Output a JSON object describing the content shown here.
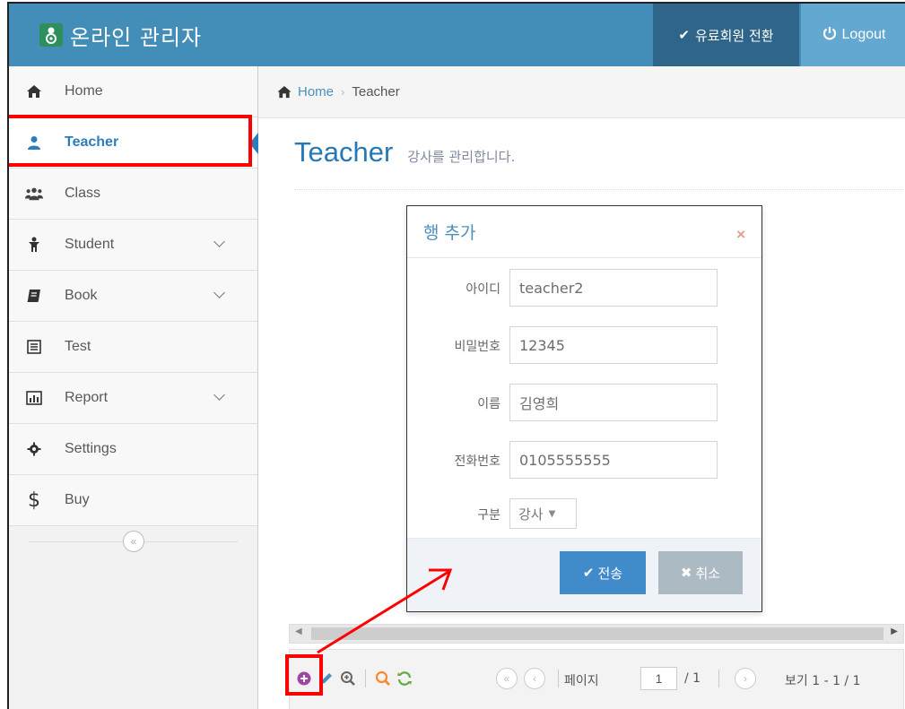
{
  "app": {
    "title": "온라인 관리자",
    "premium_label": "유료회원 전환",
    "logout_label": "Logout"
  },
  "sidebar": {
    "items": [
      {
        "label": "Home",
        "icon": "home-icon"
      },
      {
        "label": "Teacher",
        "icon": "user-icon",
        "active": true
      },
      {
        "label": "Class",
        "icon": "users-icon"
      },
      {
        "label": "Student",
        "icon": "child-icon",
        "expandable": true
      },
      {
        "label": "Book",
        "icon": "book-icon",
        "expandable": true
      },
      {
        "label": "Test",
        "icon": "list-icon"
      },
      {
        "label": "Report",
        "icon": "bar-chart-icon",
        "expandable": true
      },
      {
        "label": "Settings",
        "icon": "cog-icon"
      },
      {
        "label": "Buy",
        "icon": "dollar-icon"
      }
    ],
    "collapse_symbol": "«"
  },
  "breadcrumb": {
    "home": "Home",
    "separator": "›",
    "current": "Teacher"
  },
  "page": {
    "title": "Teacher",
    "subtitle": "강사를 관리합니다."
  },
  "dialog": {
    "title": "행 추가",
    "close_symbol": "×",
    "fields": {
      "id": {
        "label": "아이디",
        "value": "teacher2"
      },
      "password": {
        "label": "비밀번호",
        "value": "12345"
      },
      "name": {
        "label": "이름",
        "value": "김영희"
      },
      "phone": {
        "label": "전화번호",
        "value": "0105555555"
      },
      "type": {
        "label": "구분",
        "value": "강사"
      }
    },
    "submit_label": "전송",
    "cancel_label": "취소"
  },
  "pager": {
    "first_symbol": "«",
    "prev_symbol": "‹",
    "next_symbol": "›",
    "page_label": "페이지",
    "page_value": "1",
    "total_pages": "/ 1",
    "records": "보기 1 - 1 / 1"
  },
  "colors": {
    "navbar": "#438eb9",
    "accent": "#2b7dbc",
    "highlight": "#ff0000"
  }
}
